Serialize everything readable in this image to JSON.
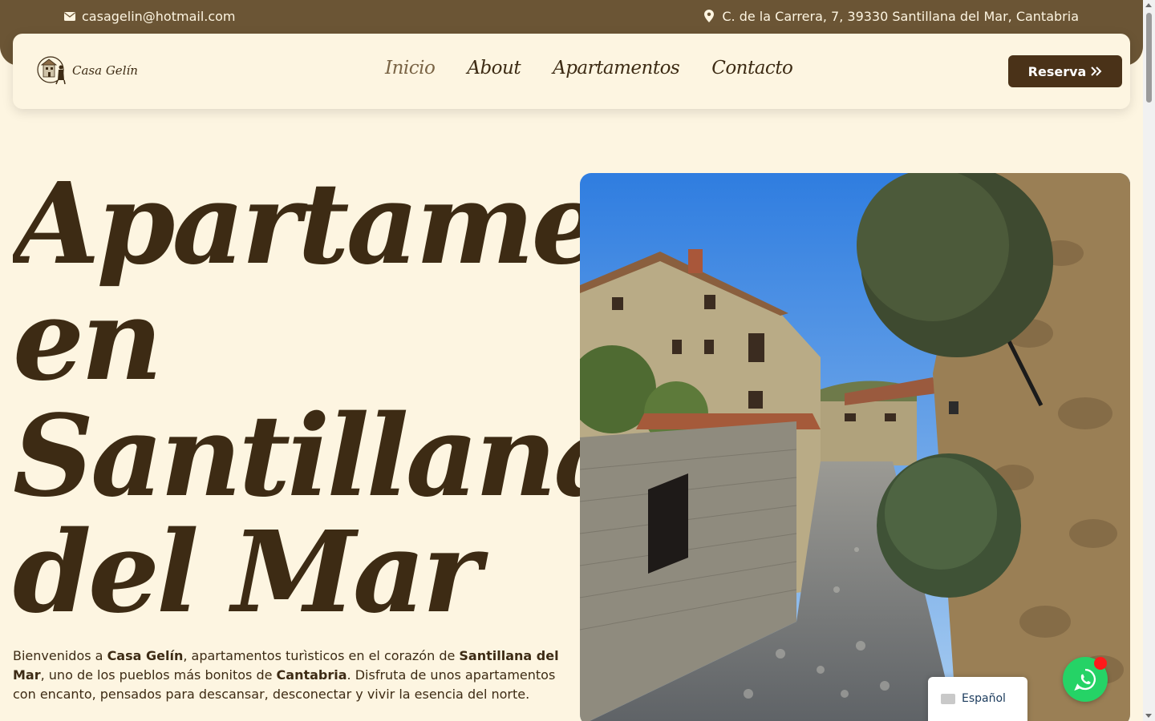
{
  "topbar": {
    "email": "casagelin@hotmail.com",
    "address": "C. de la Carrera, 7, 39330 Santillana del Mar, Cantabria",
    "mail_icon": "envelope-icon",
    "address_icon": "map-marker-icon"
  },
  "header": {
    "logo_text": "Casa Gelín",
    "nav": [
      {
        "label": "Inicio",
        "active": true
      },
      {
        "label": "About"
      },
      {
        "label": "Apartamentos"
      },
      {
        "label": "Contacto"
      }
    ],
    "cta_label": "Reserva",
    "cta_icon": "double-chevron-right-icon"
  },
  "hero": {
    "title_lines": [
      "Apartamentos",
      "en",
      "Santillana",
      "del Mar"
    ],
    "intro": {
      "p1": "Bienvenidos a ",
      "b1": "Casa Gelín",
      "p2": ", apartamentos turìsticos en el corazón de ",
      "b2": "Santillana del Mar",
      "p3": ", uno de los pueblos más bonitos de ",
      "b3": "Cantabria",
      "p4": ". Disfruta de unos apartamentos con encanto, pensados para descansar, desconectar y vivir la esencia del norte."
    }
  },
  "widgets": {
    "language": "Español",
    "whatsapp_icon": "whatsapp-icon"
  },
  "colors": {
    "background": "#fdf5e1",
    "topbar": "#6b5535",
    "primary_text": "#3d2b14",
    "button": "#4a3218",
    "whatsapp": "#25d366"
  }
}
